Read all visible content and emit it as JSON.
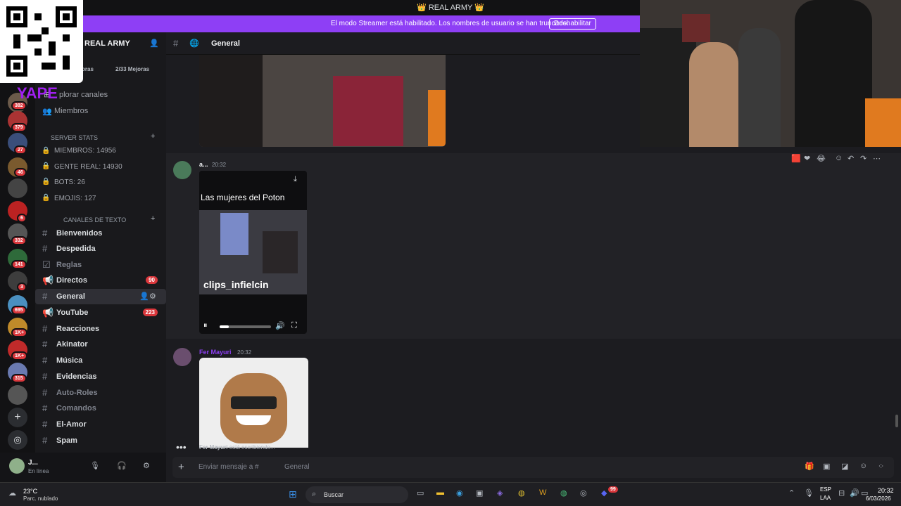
{
  "window_title": "REAL ARMY",
  "streamer_banner": {
    "message": "El modo Streamer está habilitado. Los nombres de usuario se han truncado.",
    "button": "Deshabilitar"
  },
  "overlay": {
    "yape_text": "YAPE"
  },
  "server": {
    "name": "REAL ARMY",
    "boost_label": "oras",
    "boost_progress": "2/33 Mejoras",
    "explore": "plorar canales",
    "members": "Miembros",
    "stats_category": "SERVER STATS",
    "stats": [
      "MIEMBROS: 14956",
      "GENTE REAL: 14930",
      "BOTS: 26",
      "EMOJIS: 127"
    ],
    "text_category": "CANALES DE TEXTO"
  },
  "server_rail_badges": [
    "382",
    "379",
    "27",
    "46",
    "6",
    "332",
    "141",
    "3",
    "695",
    "1K+",
    "1K+",
    "315"
  ],
  "channels": [
    {
      "name": "Bienvenidos",
      "muted": false,
      "count": ""
    },
    {
      "name": "Despedida",
      "muted": false,
      "count": ""
    },
    {
      "name": "Reglas",
      "muted": true,
      "count": ""
    },
    {
      "name": "Directos",
      "muted": false,
      "count": "90"
    },
    {
      "name": "General",
      "muted": false,
      "count": ""
    },
    {
      "name": "YouTube",
      "muted": false,
      "count": "223"
    },
    {
      "name": "Reacciones",
      "muted": false,
      "count": ""
    },
    {
      "name": "Akinator",
      "muted": false,
      "count": ""
    },
    {
      "name": "Música",
      "muted": false,
      "count": ""
    },
    {
      "name": "Evidencias",
      "muted": false,
      "count": ""
    },
    {
      "name": "Auto-Roles",
      "muted": true,
      "count": ""
    },
    {
      "name": "Comandos",
      "muted": true,
      "count": ""
    },
    {
      "name": "El-Amor",
      "muted": false,
      "count": ""
    },
    {
      "name": "Spam",
      "muted": false,
      "count": ""
    }
  ],
  "header": {
    "channel": "General"
  },
  "messages": [
    {
      "author": "a...",
      "time": "20:32",
      "video_title": "Las mujeres del Poton",
      "video_watermark": "clips_infielcin"
    },
    {
      "author": "Fer Mayuri",
      "time": "20:32"
    }
  ],
  "typing": {
    "user": "Fer Mayuri",
    "text": "está escribiendo..."
  },
  "composer": {
    "placeholder": "Enviar mensaje a #",
    "channel": "General"
  },
  "user": {
    "name": "J...",
    "status": "En línea"
  },
  "taskbar": {
    "weather_temp": "23°C",
    "weather_desc": "Parc. nublado",
    "search": "Buscar",
    "lang1": "ESP",
    "lang2": "LAA",
    "time": "20:32",
    "date": "6/03/2026",
    "discord_badge": "99"
  },
  "colors": {
    "accent": "#8e3ff5",
    "badge": "#da373c",
    "bg": "#1c1c20"
  }
}
